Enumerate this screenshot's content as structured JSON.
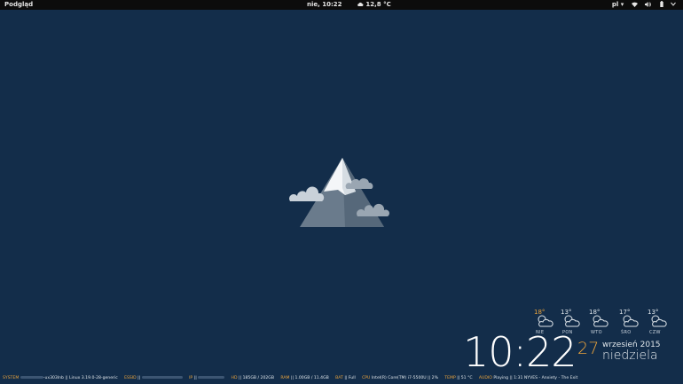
{
  "topbar": {
    "activities": "Podgląd",
    "datetime": "nie, 10:22",
    "weather": "12,8 °C",
    "language": "pl ▾"
  },
  "forecast": [
    {
      "temp": "18°",
      "day": "NIE"
    },
    {
      "temp": "13°",
      "day": "PON"
    },
    {
      "temp": "18°",
      "day": "WTO"
    },
    {
      "temp": "17°",
      "day": "ŚRO"
    },
    {
      "temp": "13°",
      "day": "CZW"
    }
  ],
  "clock": {
    "time": "10:22",
    "day_of_month": "27",
    "month_year": "wrzesień 2015",
    "day_name": "niedziela"
  },
  "status": {
    "system_label": "SYSTEM",
    "system_value": "-ux303lnb || Linux 3.19.0-28-generic",
    "essid_label": "ESSID",
    "essid_value": "||",
    "ip_label": "IP",
    "ip_value": "||",
    "hd_label": "HD",
    "hd_value": "|| 185GB / 202GB",
    "ram_label": "RAM",
    "ram_value": "|| 1.00GB / 11.4GB",
    "bat_label": "BAT",
    "bat_value": "|| Full",
    "cpu_label": "CPU",
    "cpu_value": "Intel(R) Core(TM) i7-5500U || 2%",
    "temp_label": "TEMP",
    "temp_value": "|| 51 °C",
    "audio_label": "AUDIO",
    "audio_value": "Playing || 1:31 NYVES - Anxiety - The Exit"
  },
  "colors": {
    "background": "#132d4a",
    "accent": "#e8a23c",
    "topbar": "#0c0c0c"
  },
  "icons": [
    "cloud-icon",
    "wifi-icon",
    "volume-icon",
    "battery-icon",
    "power-icon",
    "partly-cloudy-icon",
    "mountain-logo"
  ]
}
